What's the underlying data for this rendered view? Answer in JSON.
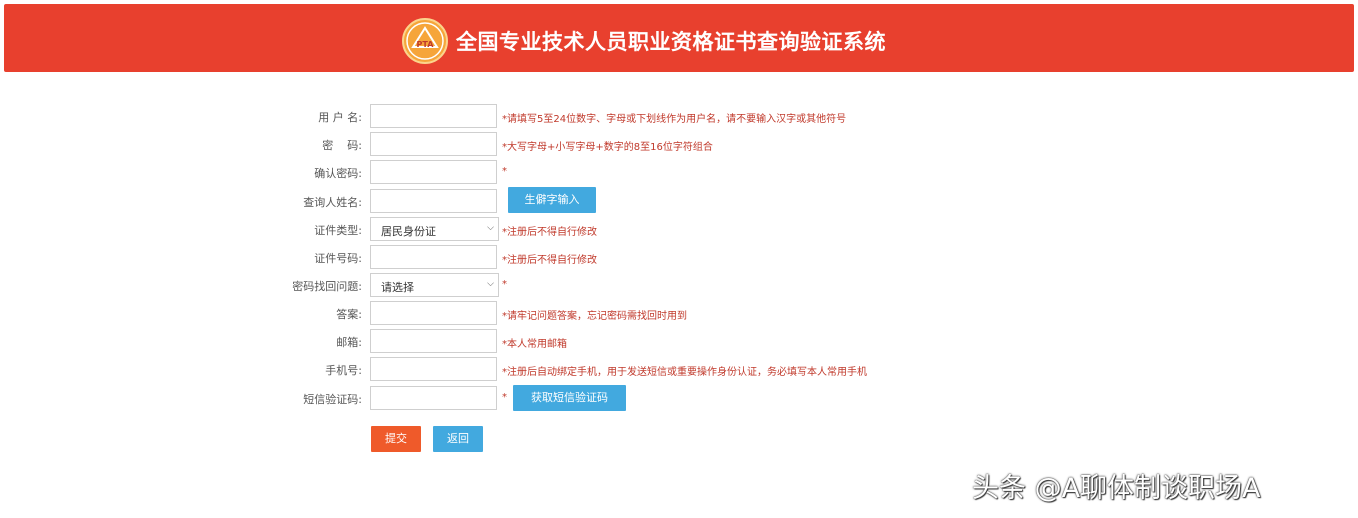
{
  "header": {
    "title": "全国专业技术人员职业资格证书查询验证系统",
    "logo_text": "PTA"
  },
  "form": {
    "username": {
      "label": "用 户 名:",
      "value": "",
      "hint": "*请填写5至24位数字、字母或下划线作为用户名，请不要输入汉字或其他符号"
    },
    "password": {
      "label": "密    码:",
      "value": "",
      "hint": "*大写字母+小写字母+数字的8至16位字符组合"
    },
    "confirm_password": {
      "label": "确认密码:",
      "value": "",
      "hint": "*"
    },
    "real_name": {
      "label": "查询人姓名:",
      "value": "",
      "hint": "",
      "button": "生僻字输入"
    },
    "id_type": {
      "label": "证件类型:",
      "value": "居民身份证",
      "hint": "*注册后不得自行修改"
    },
    "id_number": {
      "label": "证件号码:",
      "value": "",
      "hint": "*注册后不得自行修改"
    },
    "security_question": {
      "label": "密码找回问题:",
      "value": "请选择",
      "hint": "*"
    },
    "answer": {
      "label": "答案:",
      "value": "",
      "hint": "*请牢记问题答案，忘记密码需找回时用到"
    },
    "email": {
      "label": "邮箱:",
      "value": "",
      "hint": "*本人常用邮箱"
    },
    "phone": {
      "label": "手机号:",
      "value": "",
      "hint": "*注册后自动绑定手机，用于发送短信或重要操作身份认证，务必填写本人常用手机"
    },
    "sms_code": {
      "label": "短信验证码:",
      "value": "",
      "hint": "*",
      "button": "获取短信验证码"
    }
  },
  "actions": {
    "submit": "提交",
    "back": "返回"
  },
  "watermark": "头条 @A聊体制谈职场A",
  "colors": {
    "header": "#e8402e",
    "primary_button": "#42a9df",
    "submit_button": "#ef5a2a",
    "hint_text": "#c0392b"
  }
}
